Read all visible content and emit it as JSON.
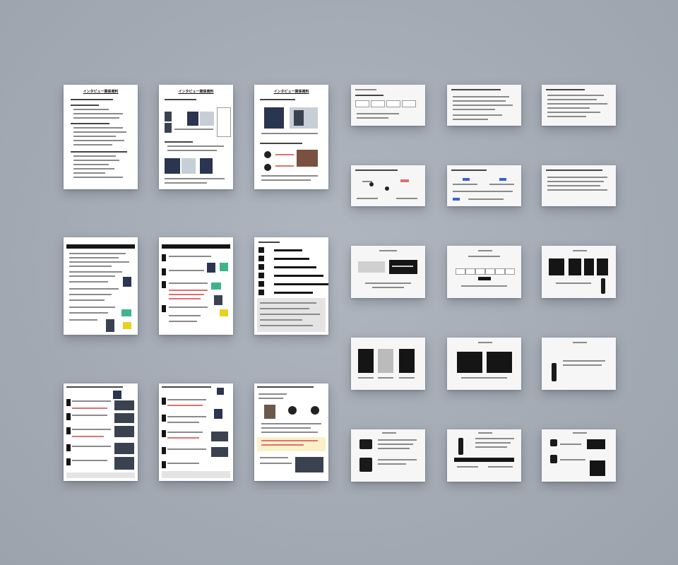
{
  "view": {
    "name": "document-page-overview"
  },
  "portrait_pages": [
    {
      "id": "p1",
      "title": "インタビュー関係資料"
    },
    {
      "id": "p2",
      "title": "インタビュー関係資料"
    },
    {
      "id": "p3",
      "title": "インタビュー関係資料"
    },
    {
      "id": "p4",
      "title": ""
    },
    {
      "id": "p5",
      "title": ""
    },
    {
      "id": "p6",
      "title": ""
    },
    {
      "id": "p7",
      "title": ""
    },
    {
      "id": "p8",
      "title": ""
    },
    {
      "id": "p9",
      "title": ""
    }
  ],
  "slide_count": 15
}
